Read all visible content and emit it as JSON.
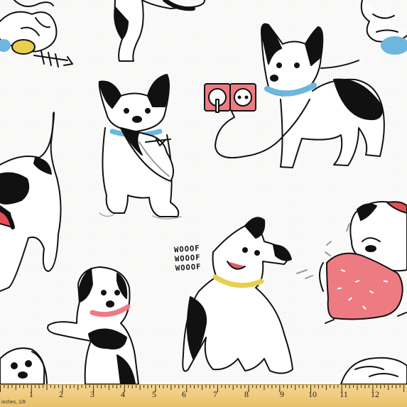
{
  "image": {
    "subject": "Fabric swatch with cartoon dog pattern",
    "colors": {
      "background": "#fbfbfa",
      "ink": "#111111",
      "collar_blue": "#6db6dd",
      "collar_yellow": "#e8cf4e",
      "accent_pink": "#ee7b82",
      "ruler": "#eecb7c"
    }
  },
  "woof_text": [
    "WOOOF",
    "WOOOF",
    "WOOOF"
  ],
  "ruler": {
    "numbers": [
      "1",
      "2",
      "3",
      "4",
      "5",
      "6",
      "7",
      "8",
      "9",
      "10",
      "11",
      "12"
    ],
    "unit_label": "inches, 1/8"
  }
}
